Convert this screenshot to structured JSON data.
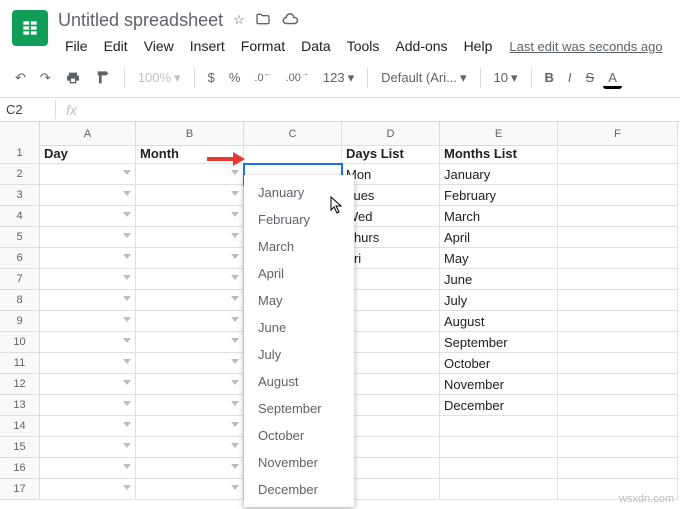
{
  "doc": {
    "title": "Untitled spreadsheet",
    "last_edit": "Last edit was seconds ago"
  },
  "menu": [
    "File",
    "Edit",
    "View",
    "Insert",
    "Format",
    "Data",
    "Tools",
    "Add-ons",
    "Help"
  ],
  "toolbar": {
    "zoom": "100%",
    "currency": "$",
    "percent": "%",
    "dec_dec": ".0",
    "dec_inc": ".00",
    "more_formats": "123",
    "font": "Default (Ari...",
    "size": "10",
    "bold": "B",
    "italic": "I",
    "strike": "S",
    "color": "A"
  },
  "namebox": "C2",
  "columns": [
    "A",
    "B",
    "C",
    "D",
    "E",
    "F"
  ],
  "rows_count": 17,
  "headers": {
    "A": "Day",
    "B": "Month",
    "D": "Days List",
    "E": "Months List"
  },
  "days_list": [
    "Mon",
    "Tues",
    "Wed",
    "Thurs",
    "Fri"
  ],
  "months_list": [
    "January",
    "February",
    "March",
    "April",
    "May",
    "June",
    "July",
    "August",
    "September",
    "October",
    "November",
    "December"
  ],
  "dropdown_options": [
    "January",
    "February",
    "March",
    "April",
    "May",
    "June",
    "July",
    "August",
    "September",
    "October",
    "November",
    "December"
  ],
  "watermark": "wsxdn.com"
}
